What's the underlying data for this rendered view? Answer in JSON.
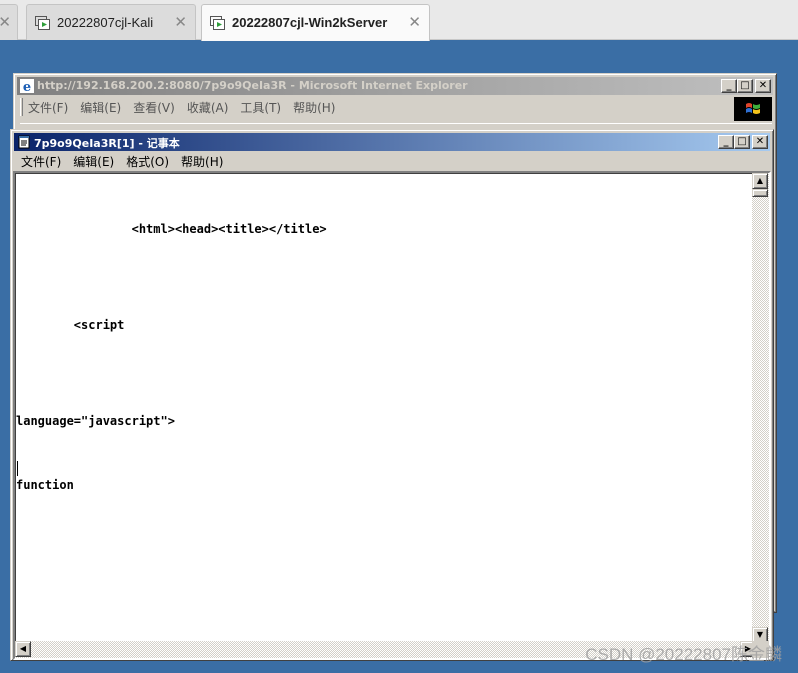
{
  "host": {
    "tabs": [
      {
        "label": "",
        "active": false
      },
      {
        "label": "20222807cjl-Kali",
        "active": false
      },
      {
        "label": "20222807cjl-Win2kServer",
        "active": true
      }
    ],
    "close_glyph": "✕"
  },
  "ie": {
    "title": "http://192.168.200.2:8080/7p9o9QeIa3R - Microsoft Internet Explorer",
    "menu": [
      "文件(F)",
      "编辑(E)",
      "查看(V)",
      "收藏(A)",
      "工具(T)",
      "帮助(H)"
    ]
  },
  "notepad": {
    "title": "7p9o9QeIa3R[1] - 记事本",
    "menu": [
      "文件(F)",
      "编辑(E)",
      "格式(O)",
      "帮助(H)"
    ],
    "lines": [
      "                <html><head><title></title>",
      "        <script",
      "language=\"javascript\">",
      "function"
    ]
  },
  "caption_buttons": {
    "minimize": "_",
    "maximize": "□",
    "close": "✕"
  },
  "watermark": "CSDN @20222807陈金麟",
  "colors": {
    "desktop": "#3a6ea5",
    "active_title_start": "#0a246a",
    "active_title_end": "#a6caf0",
    "inactive_title_start": "#808080",
    "inactive_title_end": "#c0c0c0",
    "window_face": "#d4d0c8"
  }
}
